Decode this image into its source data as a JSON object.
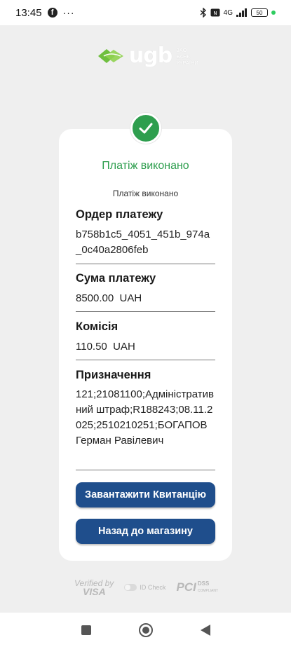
{
  "statusbar": {
    "time": "13:45",
    "dots": "···",
    "battery": "50",
    "network": "4G"
  },
  "logo": {
    "text": "ugb",
    "sub_line1": "ЗАО БАНК",
    "sub_line2": "УКРАЇНИ"
  },
  "status": {
    "title": "Платіж виконано",
    "subtitle": "Платіж виконано"
  },
  "fields": [
    {
      "label": "Ордер платежу",
      "value": "b758b1c5_4051_451b_974a_0c40a2806feb"
    },
    {
      "label": "Сума платежу",
      "value": "8500.00  UAH"
    },
    {
      "label": "Комісія",
      "value": "110.50  UAH"
    },
    {
      "label": "Призначення",
      "value": "121;21081100;Адміністративний штраф;R188243;08.11.2025;2510210251;БОГАПОВ Герман Равілевич"
    }
  ],
  "buttons": {
    "download_receipt": "Завантажити Квитанцію",
    "back_to_store": "Назад до магазину"
  },
  "badges": {
    "visa_line1": "Verified by",
    "visa_line2": "VISA",
    "idcheck": "ID Check",
    "pci": "PCI",
    "dss": "DSS",
    "dss_sub": "COMPLIANT"
  },
  "colors": {
    "success": "#2e9e4e",
    "button": "#1f4e8c",
    "background": "#efefef"
  }
}
